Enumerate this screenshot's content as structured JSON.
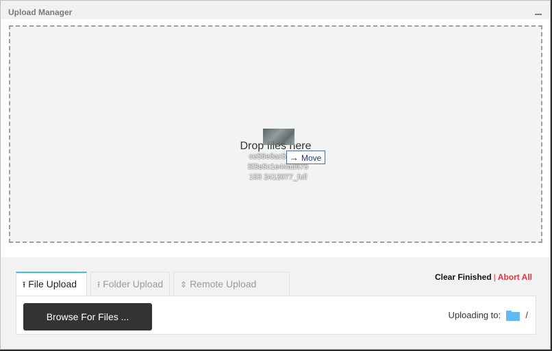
{
  "window": {
    "title": "Upload Manager"
  },
  "drop_zone": {
    "text": "Drop files here",
    "drag_preview": {
      "filename": "ce56e6ac5e54ab5f3e5c1e44ad675153 2412077_full",
      "tooltip_label": "Move",
      "tooltip_icon": "arrow-right-icon"
    }
  },
  "tabs": [
    {
      "label": "File Upload",
      "icon": "upload-icon",
      "active": true
    },
    {
      "label": "Folder Upload",
      "icon": "upload-icon",
      "active": false
    },
    {
      "label": "Remote Upload",
      "icon": "updown-arrow-icon",
      "active": false
    }
  ],
  "actions": {
    "clear_finished": "Clear Finished",
    "separator": "|",
    "abort_all": "Abort All"
  },
  "panel": {
    "browse_label": "Browse For Files ...",
    "uploading_to_label": "Uploading to:",
    "destination": "/"
  },
  "colors": {
    "accent": "#36c1e0",
    "abort": "#e8303f",
    "folder": "#62b9f0",
    "button": "#333333"
  }
}
